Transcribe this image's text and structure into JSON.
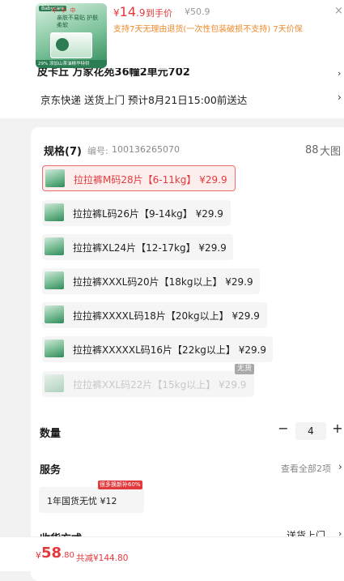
{
  "product": {
    "thumb": {
      "brand": "Babycare",
      "bubbles": "中 中 中",
      "tagline": "亲肤不易贴 护肤柔软",
      "bottom": "29% 添加山茶油精华特供"
    },
    "price_symbol": "¥",
    "price_int": "14",
    "price_dec": ".9",
    "price_label": "到手价",
    "original_price": "¥50.9",
    "return_note": "支持7天无理由退货(一次性包装破损不支持) 7天价保",
    "close_icon": "×"
  },
  "address": {
    "text": "皮卡丘 万家花苑36幢2单元702",
    "chevron": "›"
  },
  "shipping": {
    "text": "京东快递 送货上门 预计8月21日15:00前送达",
    "chevron": "›"
  },
  "spec": {
    "title": "规格(7)",
    "code_label": "编号:",
    "code": "100136265070",
    "bigpic_icon": "88",
    "bigpic_label": "大图",
    "options": [
      {
        "label": "拉拉裤M码28片【6-11kg】 ¥29.9",
        "state": "selected"
      },
      {
        "label": "拉拉裤L码26片【9-14kg】 ¥29.9",
        "state": "normal"
      },
      {
        "label": "拉拉裤XL24片【12-17kg】 ¥29.9",
        "state": "normal"
      },
      {
        "label": "拉拉裤XXXL码20片【18kg以上】 ¥29.9",
        "state": "normal"
      },
      {
        "label": "拉拉裤XXXXL码18片【20kg以上】 ¥29.9",
        "state": "normal"
      },
      {
        "label": "拉拉裤XXXXXL码16片【22kg以上】 ¥29.9",
        "state": "normal"
      },
      {
        "label": "拉拉裤XXL码22片【15kg以上】 ¥29.9",
        "state": "disabled"
      }
    ],
    "soldout_badge": "无货"
  },
  "quantity": {
    "label": "数量",
    "minus": "−",
    "value": "4",
    "plus": "+"
  },
  "service": {
    "label": "服务",
    "view_all": "查看全部2项",
    "chevron": "›",
    "chip_text": "1年国货无忧 ¥12",
    "chip_badge": "很多换新补60%"
  },
  "receive": {
    "label": "收货方式",
    "value": "送货上门",
    "chevron": "›"
  },
  "bottom_bar": {
    "currency": "¥",
    "total_int": "58",
    "total_dec": ".80",
    "saved": "共减¥144.80"
  },
  "colors": {
    "accent_red": "#e4393c",
    "orange_note": "#ee8a2b",
    "selected_bg": "#fdeeee",
    "selected_border": "#ee6d6d"
  }
}
